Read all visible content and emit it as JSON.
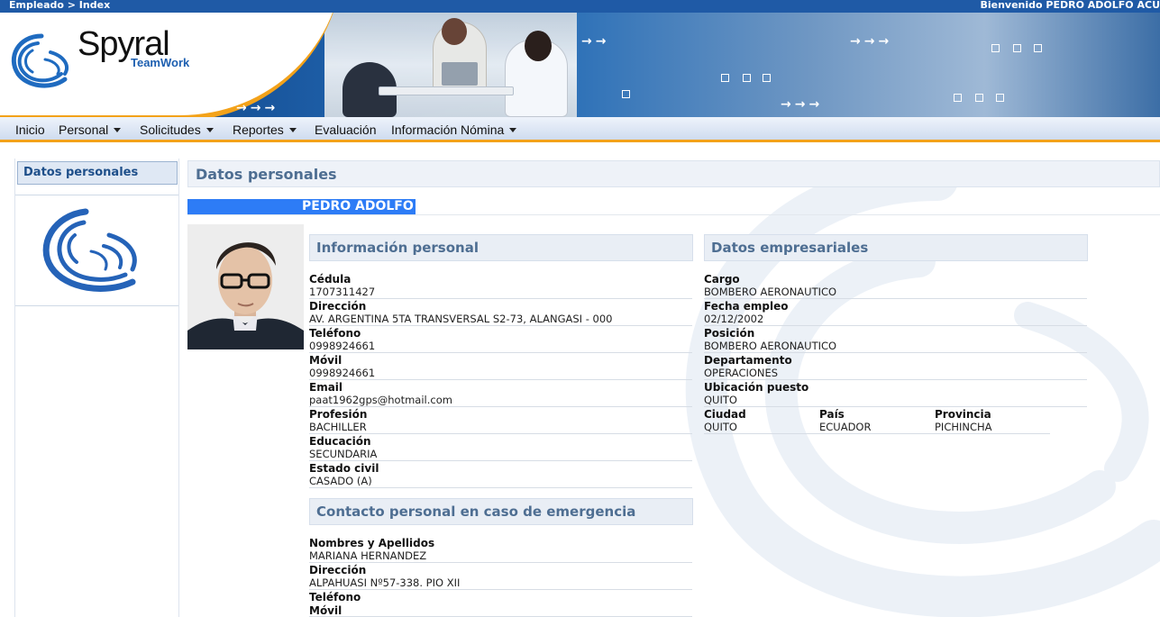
{
  "topbar": {
    "breadcrumb": "Empleado > Index",
    "welcome": "Bienvenido PEDRO ADOLFO ACU"
  },
  "brand": {
    "name": "Spyral",
    "sub": "TeamWork"
  },
  "nav": [
    {
      "label": "Inicio",
      "dropdown": false
    },
    {
      "label": "Personal",
      "dropdown": true
    },
    {
      "label": "Solicitudes",
      "dropdown": true
    },
    {
      "label": "Reportes",
      "dropdown": true
    },
    {
      "label": "Evaluación",
      "dropdown": false
    },
    {
      "label": "Información Nómina",
      "dropdown": true
    }
  ],
  "sidebar": {
    "heading": "Datos personales"
  },
  "main": {
    "heading": "Datos personales",
    "employee_name": "PEDRO ADOLFO"
  },
  "personal": {
    "heading": "Información personal",
    "fields": [
      {
        "label": "Cédula",
        "value": "1707311427"
      },
      {
        "label": "Dirección",
        "value": "AV. ARGENTINA 5TA TRANSVERSAL S2-73, ALANGASI - 000"
      },
      {
        "label": "Teléfono",
        "value": "0998924661"
      },
      {
        "label": "Móvil",
        "value": "0998924661"
      },
      {
        "label": "Email",
        "value": "paat1962gps@hotmail.com"
      },
      {
        "label": "Profesión",
        "value": "BACHILLER"
      },
      {
        "label": "Educación",
        "value": "SECUNDARIA"
      },
      {
        "label": "Estado civil",
        "value": "CASADO (A)"
      }
    ]
  },
  "emergency": {
    "heading": "Contacto personal en caso de emergencia",
    "fields": [
      {
        "label": "Nombres y Apellidos",
        "value": "MARIANA HERNANDEZ"
      },
      {
        "label": "Dirección",
        "value": "ALPAHUASI Nº57-338. PIO XII"
      },
      {
        "label": "Teléfono",
        "value": ""
      },
      {
        "label": "Móvil",
        "value": ""
      }
    ]
  },
  "business": {
    "heading": "Datos empresariales",
    "fields": [
      {
        "label": "Cargo",
        "value": "BOMBERO AERONAUTICO"
      },
      {
        "label": "Fecha empleo",
        "value": "02/12/2002"
      },
      {
        "label": "Posición",
        "value": "BOMBERO AERONAUTICO"
      },
      {
        "label": "Departamento",
        "value": "OPERACIONES"
      },
      {
        "label": "Ubicación puesto",
        "value": "QUITO"
      }
    ],
    "location": [
      {
        "label": "Ciudad",
        "value": "QUITO"
      },
      {
        "label": "País",
        "value": "ECUADOR"
      },
      {
        "label": "Provincia",
        "value": "PICHINCHA"
      }
    ]
  },
  "colors": {
    "topbar": "#1f5aa6",
    "accent": "#f3a21a",
    "section_heading": "#4e6e92",
    "selection": "#2d7cf6"
  }
}
